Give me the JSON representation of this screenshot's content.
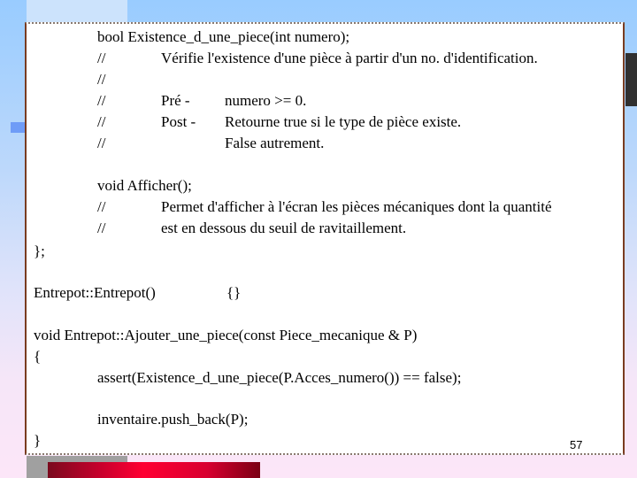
{
  "slide": {
    "code_lines": {
      "decl_existence": "bool Existence_d_une_piece(int numero);",
      "comment_marker": "//",
      "existence_desc": "Vérifie l'existence d'une pièce à partir d'un no. d'identification.",
      "pre_label": "Pré -",
      "pre_value": "numero >= 0.",
      "post_label": "Post -",
      "post_value": "Retourne true si le type de pièce existe.",
      "post_value_2": "False autrement.",
      "decl_afficher": "void Afficher();",
      "afficher_desc_1": "Permet d'afficher à l'écran les pièces mécaniques dont la quantité",
      "afficher_desc_2": "est en dessous du seuil de ravitaillement.",
      "class_end": "};",
      "constructor": "Entrepot::Entrepot()",
      "constructor_body": "{}",
      "ajouter_signature": "void Entrepot::Ajouter_une_piece(const Piece_mecanique & P)",
      "open_brace": "{",
      "assert_stmt": "assert(Existence_d_une_piece(P.Acces_numero()) == false);",
      "push_back_stmt": "inventaire.push_back(P);",
      "close_brace": "}"
    },
    "page_number": "57"
  },
  "theme": {
    "background_top": "#99ccff",
    "background_bottom": "#fce6f8",
    "box_border": "#7a3c20",
    "accent_red": "#ff0033",
    "accent_blue": "#6f9cf7",
    "dark_block": "#303030"
  }
}
